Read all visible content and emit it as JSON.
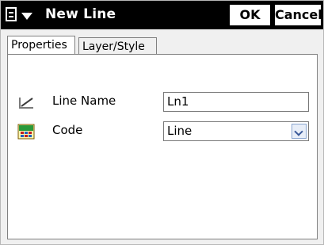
{
  "window": {
    "title": "New Line",
    "ok_label": "OK",
    "cancel_label": "Cancel"
  },
  "tabs": [
    {
      "label": "Properties",
      "active": true
    },
    {
      "label": "Layer/Style",
      "active": false
    }
  ],
  "form": {
    "line_name": {
      "label": "Line Name",
      "value": "Ln1",
      "icon": "line-icon"
    },
    "code": {
      "label": "Code",
      "value": "Line",
      "icon": "code-icon"
    }
  },
  "colors": {
    "titlebar": "#000000",
    "title_text": "#ffffff",
    "panel": "#ffffff",
    "dropdown_arrow": "#3a5a9a"
  }
}
